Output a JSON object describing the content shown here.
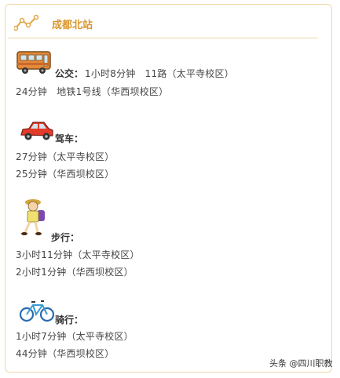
{
  "header": {
    "title": "成都北站",
    "icon": "line-chart-icon",
    "accent_color": "#d9962b",
    "border_color": "#f0d8a8"
  },
  "modes": [
    {
      "icon": "bus-icon",
      "label": "公交：",
      "lines": [
        "1小时8分钟　11路（太平寺校区）",
        "24分钟　地铁1号线（华西坝校区）"
      ]
    },
    {
      "icon": "car-icon",
      "label": "驾车：",
      "lines": [
        "27分钟（太平寺校区）",
        "25分钟（华西坝校区）"
      ]
    },
    {
      "icon": "walking-person-icon",
      "label": "步行：",
      "lines": [
        "3小时11分钟（太平寺校区）",
        "2小时1分钟（华西坝校区）"
      ]
    },
    {
      "icon": "bicycle-icon",
      "label": "骑行：",
      "lines": [
        "1小时7分钟（太平寺校区）",
        "44分钟（华西坝校区）"
      ]
    }
  ],
  "watermark": "头条 @四川职教"
}
